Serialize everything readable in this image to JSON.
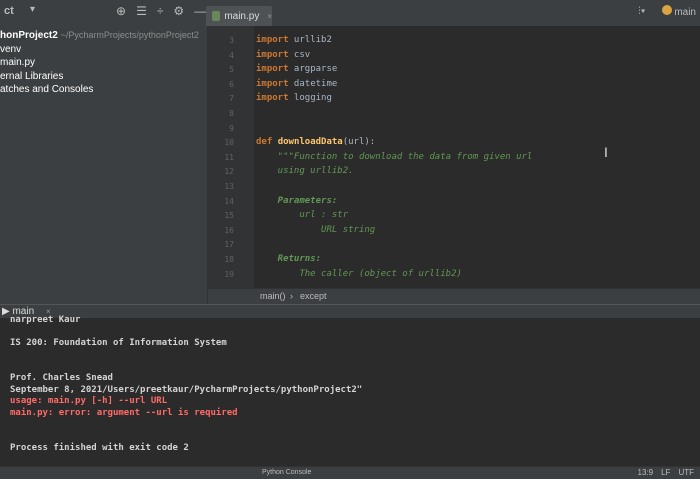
{
  "topbar": {
    "project_label": "ct",
    "icons": [
      "globe-icon",
      "collapse-icon",
      "expand-icon",
      "gear-icon",
      "minimize-icon"
    ],
    "right_icons": [
      "run-config-icon",
      "user-icon"
    ],
    "right_label": "main"
  },
  "tab": {
    "label": "main.py",
    "close": "×"
  },
  "project_tree": {
    "root_name": "honProject2",
    "root_path": "~/PycharmProjects/pythonProject2",
    "items": [
      "venv",
      "main.py",
      "ernal Libraries",
      "atches and Consoles"
    ]
  },
  "editor": {
    "lines": [
      {
        "n": "3",
        "parts": [
          {
            "c": "kw",
            "t": "import"
          },
          {
            "c": "",
            "t": " urllib2"
          }
        ]
      },
      {
        "n": "4",
        "parts": [
          {
            "c": "kw",
            "t": "import"
          },
          {
            "c": "",
            "t": " csv"
          }
        ]
      },
      {
        "n": "5",
        "parts": [
          {
            "c": "kw",
            "t": "import"
          },
          {
            "c": "",
            "t": " argparse"
          }
        ]
      },
      {
        "n": "6",
        "parts": [
          {
            "c": "kw",
            "t": "import"
          },
          {
            "c": "",
            "t": " datetime"
          }
        ]
      },
      {
        "n": "7",
        "parts": [
          {
            "c": "kw",
            "t": "import"
          },
          {
            "c": "",
            "t": " logging"
          }
        ]
      },
      {
        "n": "8",
        "parts": []
      },
      {
        "n": "9",
        "parts": []
      },
      {
        "n": "10",
        "parts": [
          {
            "c": "kw",
            "t": "def"
          },
          {
            "c": "",
            "t": " "
          },
          {
            "c": "fn",
            "t": "downloadData"
          },
          {
            "c": "",
            "t": "(url):"
          }
        ]
      },
      {
        "n": "11",
        "parts": [
          {
            "c": "doc",
            "t": "    \"\"\"Function to download the data from given url"
          }
        ]
      },
      {
        "n": "12",
        "parts": [
          {
            "c": "doc",
            "t": "    using urllib2."
          }
        ]
      },
      {
        "n": "13",
        "parts": []
      },
      {
        "n": "14",
        "parts": [
          {
            "c": "doc-tag",
            "t": "    Parameters:"
          }
        ]
      },
      {
        "n": "15",
        "parts": [
          {
            "c": "doc",
            "t": "        url : str"
          }
        ]
      },
      {
        "n": "16",
        "parts": [
          {
            "c": "doc",
            "t": "            URL string"
          }
        ]
      },
      {
        "n": "17",
        "parts": []
      },
      {
        "n": "18",
        "parts": [
          {
            "c": "doc-tag",
            "t": "    Returns:"
          }
        ]
      },
      {
        "n": "19",
        "parts": [
          {
            "c": "doc",
            "t": "        The caller (object of urllib2)"
          }
        ]
      }
    ]
  },
  "breadcrumbs": {
    "items": [
      "main()",
      "except"
    ],
    "separator": "›"
  },
  "run_window": {
    "tab_label": "main",
    "close": "×"
  },
  "console": {
    "lines": [
      {
        "t": "narpreet Kaur",
        "type": "normal"
      },
      {
        "t": "",
        "type": "normal"
      },
      {
        "t": "IS 200: Foundation of Information System",
        "type": "normal"
      },
      {
        "t": "",
        "type": "normal"
      },
      {
        "t": "",
        "type": "normal"
      },
      {
        "t": "Prof. Charles Snead",
        "type": "normal"
      },
      {
        "t": "September 8, 2021/Users/preetkaur/PycharmProjects/pythonProject2\"",
        "type": "normal"
      },
      {
        "t": "usage: main.py [-h] --url URL",
        "type": "err"
      },
      {
        "t": "main.py: error: argument --url is required",
        "type": "err"
      },
      {
        "t": "",
        "type": "normal"
      },
      {
        "t": "",
        "type": "normal"
      },
      {
        "t": "Process finished with exit code 2",
        "type": "normal"
      }
    ]
  },
  "status_bar": {
    "position": "13:9",
    "line_sep": "LF",
    "encoding": "UTF",
    "bottom_label": "Python Console"
  },
  "colors": {
    "keyword": "#cc7832",
    "function": "#ffc66d",
    "docstring": "#629755",
    "error": "#ff6b68",
    "background": "#2b2b2b"
  }
}
